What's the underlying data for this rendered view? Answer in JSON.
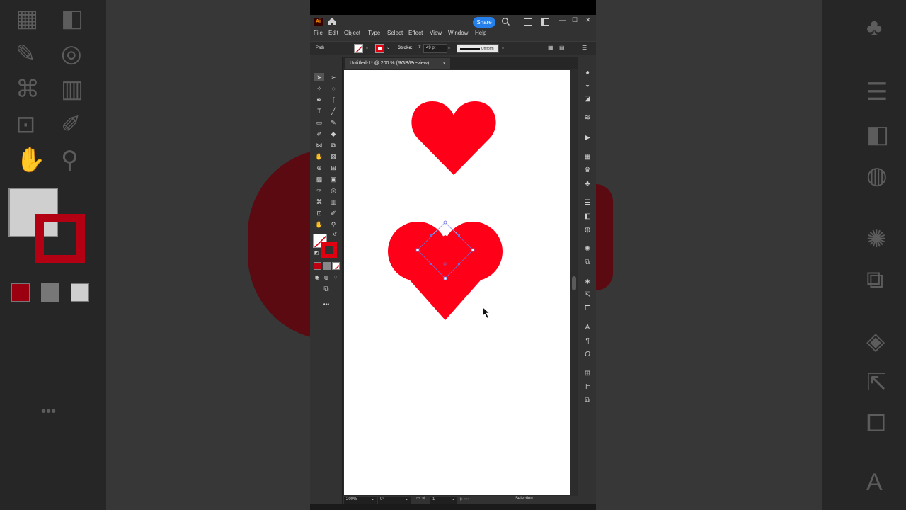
{
  "app": {
    "logo": "Ai",
    "share_label": "Share",
    "menus": [
      "File",
      "Edit",
      "Object",
      "Type",
      "Select",
      "Effect",
      "View",
      "Window",
      "Help"
    ]
  },
  "control_bar": {
    "selection_type": "Path",
    "stroke_label": "Stroke:",
    "stroke_weight": "49 pt",
    "stroke_profile": "Uniform"
  },
  "document": {
    "tab_title": "Untitled-1* @ 200 % (RGB/Preview)",
    "close_glyph": "×"
  },
  "status": {
    "zoom": "200%",
    "rotation": "0°",
    "artboard_num": "1",
    "tool_name": "Selection"
  },
  "colors": {
    "heart": "#fe0018",
    "selection": "#6f6fd8",
    "accent": "#2680eb"
  },
  "icons": {
    "home": "home-icon",
    "search": "search-icon",
    "more_tools": "•••"
  }
}
